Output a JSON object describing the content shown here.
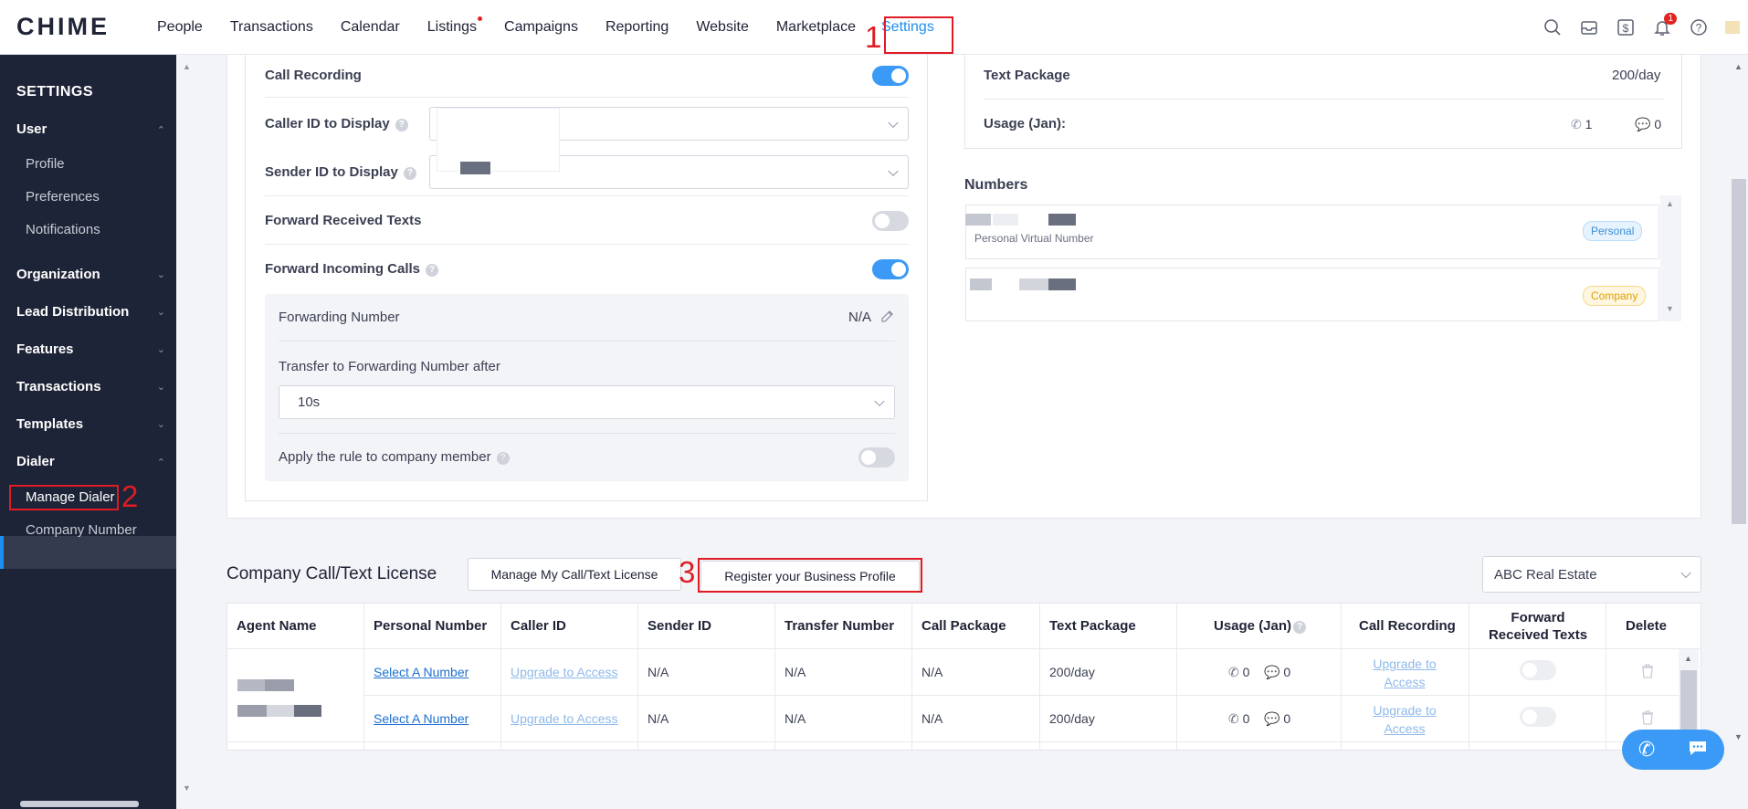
{
  "header": {
    "logo": "CHIME",
    "nav": [
      "People",
      "Transactions",
      "Calendar",
      "Listings",
      "Campaigns",
      "Reporting",
      "Website",
      "Marketplace",
      "Settings"
    ],
    "active_nav": "Settings",
    "notification_count": "1",
    "icons": [
      "search-icon",
      "inbox-icon",
      "dollar-icon",
      "bell-icon",
      "help-icon"
    ]
  },
  "annotations": {
    "n1": "1",
    "n2": "2",
    "n3": "3"
  },
  "sidebar": {
    "title": "SETTINGS",
    "sections": [
      {
        "label": "User",
        "items": [
          "Profile",
          "Preferences",
          "Notifications"
        ]
      },
      {
        "label": "Organization"
      },
      {
        "label": "Lead Distribution"
      },
      {
        "label": "Features"
      },
      {
        "label": "Transactions"
      },
      {
        "label": "Templates"
      },
      {
        "label": "Dialer",
        "items": [
          "Manage Dialer",
          "Company Number"
        ]
      }
    ]
  },
  "settings": {
    "call_recording": "Call Recording",
    "caller_id": "Caller ID to Display",
    "sender_id": "Sender ID to Display",
    "forward_texts": "Forward Received Texts",
    "forward_calls": "Forward Incoming Calls",
    "forwarding_number": "Forwarding Number",
    "forwarding_value": "N/A",
    "transfer_label": "Transfer to Forwarding Number after",
    "transfer_value": "10s",
    "apply_rule": "Apply the rule to company member",
    "toggles": {
      "call_recording": true,
      "forward_texts": false,
      "forward_calls": true,
      "apply_rule": false
    }
  },
  "package": {
    "text_package": "Text Package",
    "text_value": "200/day",
    "usage_label": "Usage (Jan):",
    "calls": "1",
    "texts": "0"
  },
  "numbers": {
    "title": "Numbers",
    "items": [
      {
        "sub": "Personal Virtual Number",
        "tag": "Personal"
      },
      {
        "sub": "",
        "tag": "Company"
      }
    ]
  },
  "license": {
    "title": "Company Call/Text License",
    "manage_btn": "Manage My Call/Text License",
    "register_btn": "Register your Business Profile",
    "company_select": "ABC Real Estate",
    "columns": [
      "Agent Name",
      "Personal Number",
      "Caller ID",
      "Sender ID",
      "Transfer Number",
      "Call Package",
      "Text Package",
      "Usage (Jan)",
      "Call Recording",
      "Forward Received Texts",
      "Delete"
    ],
    "rows": [
      {
        "personal": "Select A Number",
        "caller": "Upgrade to Access",
        "sender": "N/A",
        "transfer": "N/A",
        "call_pkg": "N/A",
        "text_pkg": "200/day",
        "calls": "0",
        "texts": "0",
        "recording": "Upgrade to Access"
      },
      {
        "personal": "Select A Number",
        "caller": "Upgrade to Access",
        "sender": "N/A",
        "transfer": "N/A",
        "call_pkg": "N/A",
        "text_pkg": "200/day",
        "calls": "0",
        "texts": "0",
        "recording": "Upgrade to Access"
      }
    ]
  }
}
